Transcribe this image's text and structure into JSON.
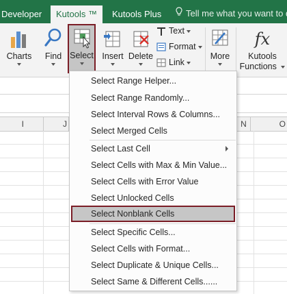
{
  "tabs": {
    "developer": "Developer",
    "kutools": "Kutools ™",
    "kutools_plus": "Kutools Plus",
    "tell_me": "Tell me what you want to d"
  },
  "ribbon": {
    "charts": "Charts",
    "find": "Find",
    "select": "Select",
    "insert": "Insert",
    "delete": "Delete",
    "text": "Text",
    "format": "Format",
    "link": "Link",
    "more": "More",
    "kutools_functions_line1": "Kutools",
    "kutools_functions_line2": "Functions",
    "fx_glyph": "fx"
  },
  "columns": [
    "I",
    "J",
    "N",
    "O"
  ],
  "menu": {
    "items": [
      "Select Range Helper...",
      "Select Range Randomly...",
      "Select Interval Rows & Columns...",
      "Select Merged Cells",
      "Select Last Cell",
      "Select Cells with Max & Min Value...",
      "Select Cells with Error Value",
      "Select Unlocked Cells",
      "Select Nonblank Cells",
      "Select Specific Cells...",
      "Select Cells with Format...",
      "Select Duplicate & Unique Cells...",
      "Select Same & Different Cells......"
    ],
    "highlighted_index": 8,
    "submenu_index": 4
  },
  "colors": {
    "ribbon_green": "#227447",
    "selection_border": "#7a1d26",
    "highlight_bg": "#c6c6c6"
  },
  "icons": {
    "charts": "bar-chart-icon",
    "find": "magnifier-icon",
    "select": "select-cursor-icon",
    "insert": "insert-table-icon",
    "delete": "delete-table-icon",
    "text": "text-T-icon",
    "format": "format-icon",
    "link": "link-icon",
    "more": "more-grid-icon",
    "tell_me": "lightbulb-icon"
  }
}
